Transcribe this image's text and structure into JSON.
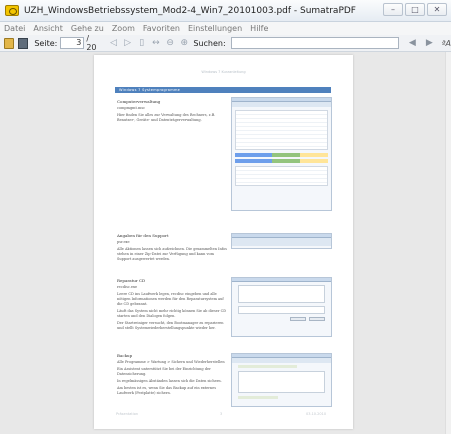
{
  "window": {
    "title": "UZH_WindowsBetriebssystem_Mod2-4_Win7_20101003.pdf - SumatraPDF",
    "controls": [
      "–",
      "□",
      "✕"
    ]
  },
  "menu": [
    "Datei",
    "Ansicht",
    "Gehe zu",
    "Zoom",
    "Favoriten",
    "Einstellungen",
    "Hilfe"
  ],
  "toolbar": {
    "page_label": "Seite:",
    "page_value": "3",
    "page_total": "/ 20",
    "search_label": "Suchen:",
    "search_value": "",
    "match_case": "ªA"
  },
  "document": {
    "header": "Windows 7 Kurzanleitung",
    "section_title": "Windows 7 Systemprogramme",
    "blocks": [
      {
        "heading": "Computerverwaltung",
        "sub": "compmgmt.msc",
        "paragraphs": [
          "Hier finden Sie alles zur Verwaltung des Rechners, z.B. Benutzer-, Geräte- und Datenträgerverwaltung."
        ]
      },
      {
        "heading": "Angaben für den Support",
        "sub": "psr.exe",
        "paragraphs": [
          "Alle Aktionen lassen sich aufzeichnen. Die gesammelten Infos stehen in einer Zip-Datei zur Verfügung und kann vom Support ausgewertet werden."
        ]
      },
      {
        "heading": "Reparatur CD",
        "sub": "recdisc.exe",
        "paragraphs": [
          "Leere CD ins Laufwerk legen, recdisc eingeben und alle nötigen Informationen werden für den Reparatursystem auf die CD gebrannt.",
          "Läuft das System nicht mehr richtig können Sie ab dieser CD starten und den Dialogen folgen.",
          "Der Startreiniger versucht, den Bootmanager zu reparieren und stellt Systemwiederherstellungspunkte wieder her."
        ]
      },
      {
        "heading": "Backup",
        "sub": "Alle Programme > Wartung > Sichern und Wiederherstellen",
        "paragraphs": [
          "Ein Assistent unterstützt Sie bei der Einrichtung der Datensicherung.",
          "In regelmässigen Abständen lassen sich die Daten sichern.",
          "Am besten ist es, wenn Sie das Backup auf ein externes Laufwerk (Festplatte) sichern."
        ]
      }
    ],
    "footer": {
      "left": "Präsentation",
      "center": "3",
      "right": "03.10.2010"
    }
  },
  "colors": {
    "section_bar": "#4f81bd",
    "viewport_bg": "#e8e8e8"
  }
}
